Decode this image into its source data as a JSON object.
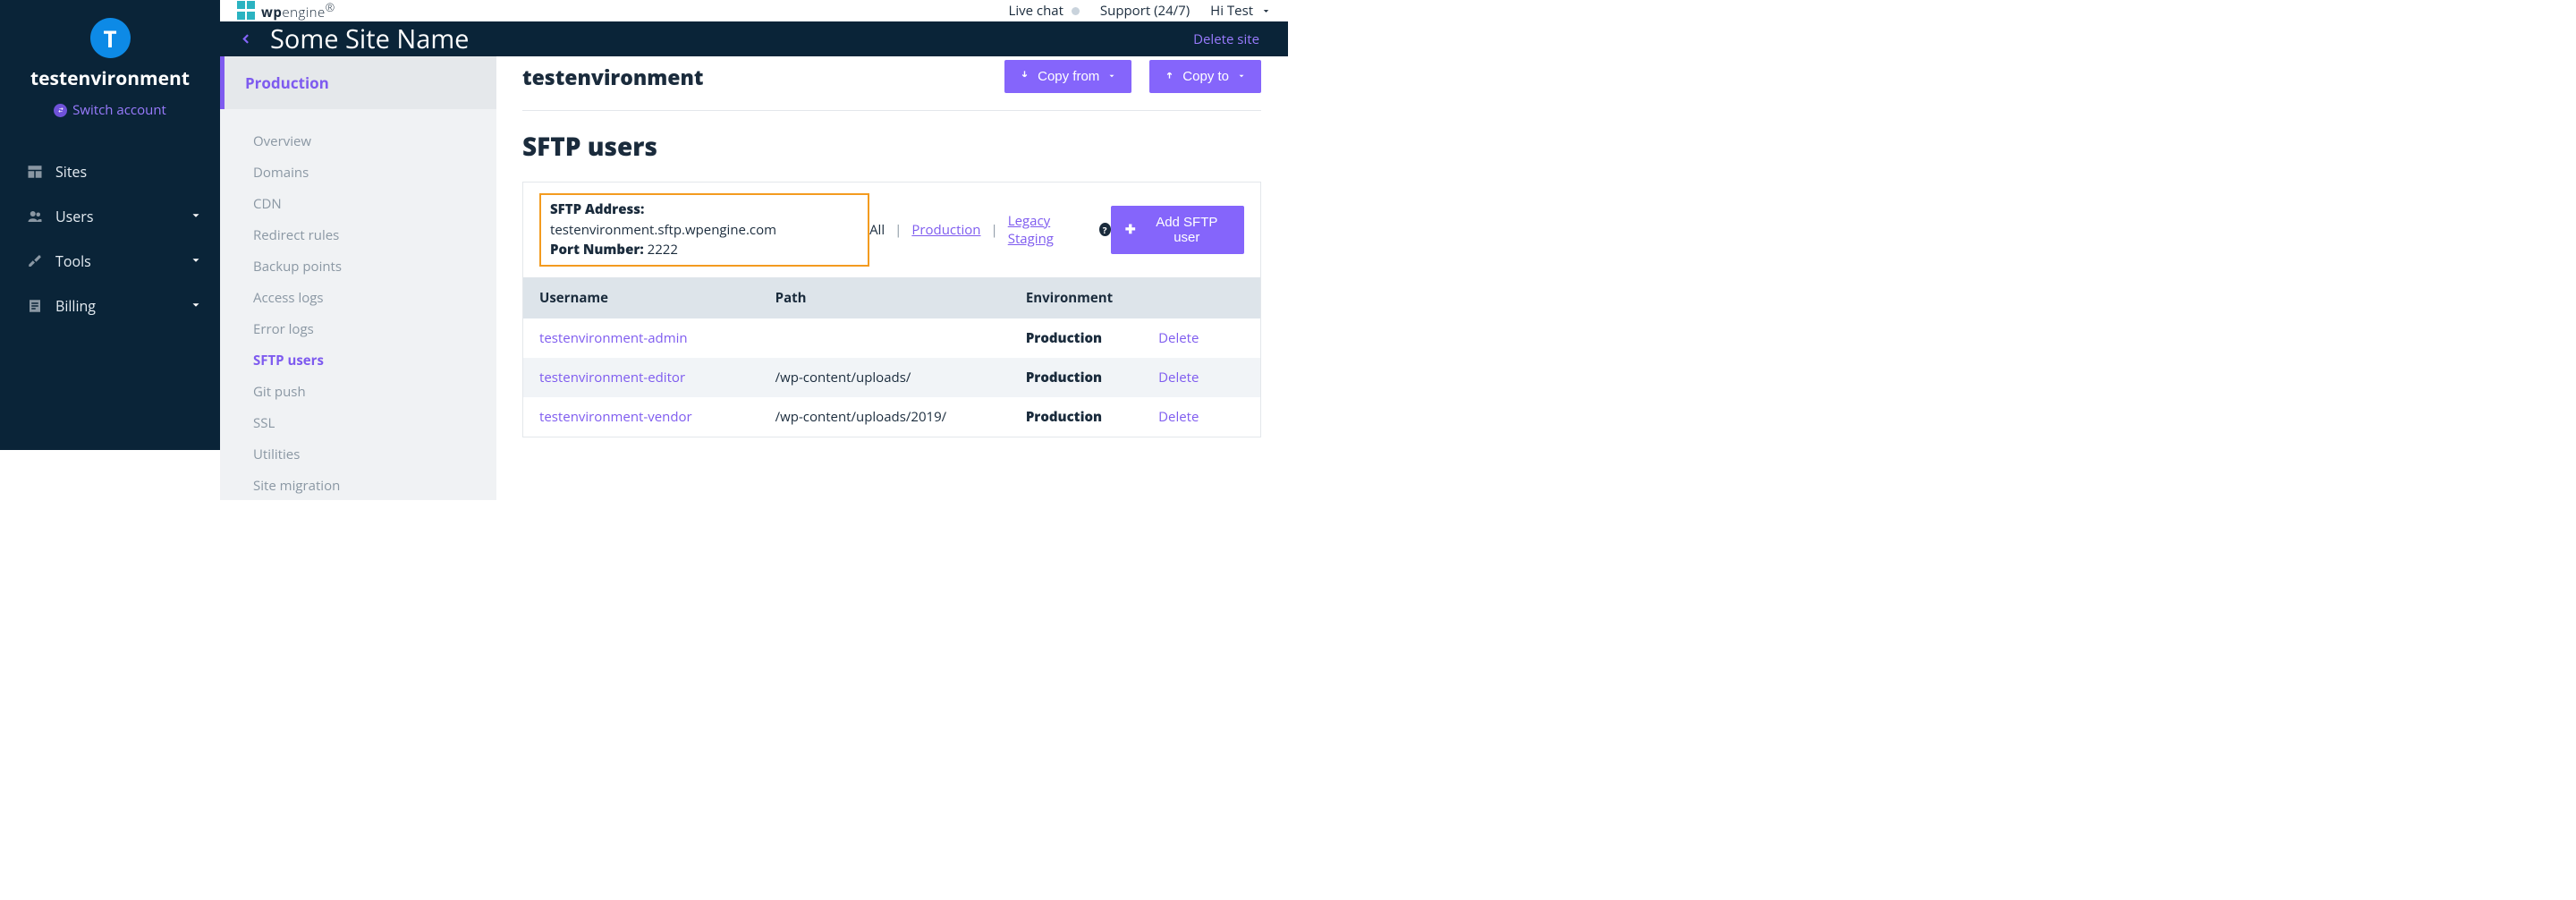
{
  "account": {
    "avatar_letter": "T",
    "name": "testenvironment",
    "switch_label": "Switch account"
  },
  "nav": [
    {
      "label": "Sites",
      "icon": "grid",
      "expandable": false
    },
    {
      "label": "Users",
      "icon": "users",
      "expandable": true
    },
    {
      "label": "Tools",
      "icon": "tools",
      "expandable": true
    },
    {
      "label": "Billing",
      "icon": "billing",
      "expandable": true
    }
  ],
  "topbar": {
    "brand_prefix": "wp",
    "brand_suffix": "engine",
    "brand_mark": "®",
    "live_chat": "Live chat",
    "support": "Support (24/7)",
    "user_greeting": "Hi Test"
  },
  "hero": {
    "site_title": "Some Site Name",
    "delete_label": "Delete site"
  },
  "secondary": {
    "env_tab": "Production",
    "items": [
      "Overview",
      "Domains",
      "CDN",
      "Redirect rules",
      "Backup points",
      "Access logs",
      "Error logs",
      "SFTP users",
      "Git push",
      "SSL",
      "Utilities",
      "Site migration"
    ],
    "active_index": 7
  },
  "main": {
    "env_name": "testenvironment",
    "copy_from": "Copy from",
    "copy_to": "Copy to",
    "section_title": "SFTP users",
    "sftp_address_label": "SFTP Address:",
    "sftp_address_value": "testenvironment.sftp.wpengine.com",
    "port_label": "Port Number:",
    "port_value": "2222",
    "filter_all": "All",
    "filter_production": "Production",
    "filter_legacy": "Legacy Staging",
    "add_button": "Add SFTP user",
    "table": {
      "headers": [
        "Username",
        "Path",
        "Environment",
        ""
      ],
      "rows": [
        {
          "username": "testenvironment-admin",
          "path": "",
          "env": "Production",
          "delete": "Delete"
        },
        {
          "username": "testenvironment-editor",
          "path": "/wp-content/uploads/",
          "env": "Production",
          "delete": "Delete"
        },
        {
          "username": "testenvironment-vendor",
          "path": "/wp-content/uploads/2019/",
          "env": "Production",
          "delete": "Delete"
        }
      ]
    }
  }
}
